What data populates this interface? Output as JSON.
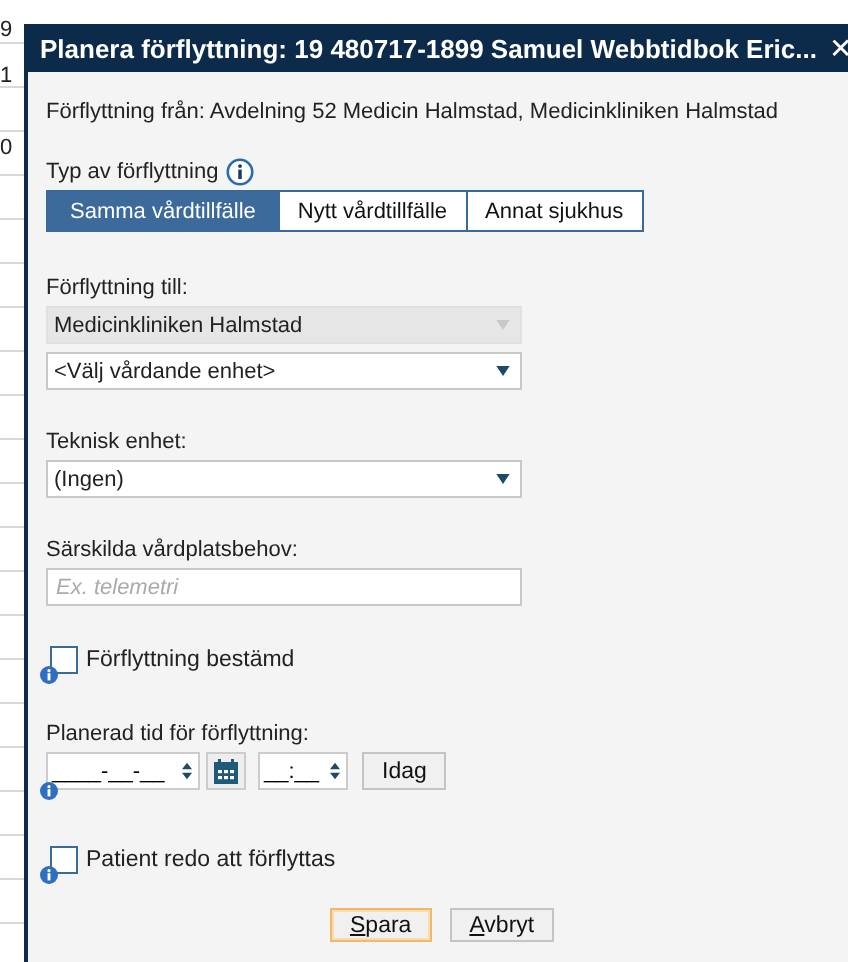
{
  "background_rows": [
    "9",
    "1",
    "0"
  ],
  "window": {
    "title": "Planera förflyttning: 19 480717-1899 Samuel Webbtidbok Eric...",
    "close": "✕"
  },
  "from_text": "Förflyttning från: Avdelning 52 Medicin Halmstad, Medicinkliniken Halmstad",
  "transfer_type": {
    "label": "Typ av förflyttning",
    "options": [
      {
        "label": "Samma vårdtillfälle",
        "selected": true
      },
      {
        "label": "Nytt vårdtillfälle",
        "selected": false
      },
      {
        "label": "Annat sjukhus",
        "selected": false
      }
    ]
  },
  "transfer_to": {
    "label": "Förflyttning till:",
    "selects": [
      {
        "value": "Medicinkliniken Halmstad",
        "disabled": true
      },
      {
        "value": "<Välj vårdande enhet>",
        "disabled": false
      }
    ]
  },
  "technical_unit": {
    "label": "Teknisk enhet:",
    "value": "(Ingen)"
  },
  "special_needs": {
    "label": "Särskilda vårdplatsbehov:",
    "placeholder": "Ex. telemetri"
  },
  "transfer_decided": {
    "label": "Förflyttning bestämd",
    "checked": false
  },
  "planned_time": {
    "label": "Planerad tid för förflyttning:",
    "date": "____-__-__",
    "time": "__:__",
    "today_button": "Idag"
  },
  "patient_ready": {
    "label": "Patient redo att förflyttas",
    "checked": false
  },
  "buttons": [
    {
      "mnemonic": "S",
      "rest": "para",
      "default": true
    },
    {
      "mnemonic": "A",
      "rest": "vbryt",
      "default": false
    }
  ]
}
